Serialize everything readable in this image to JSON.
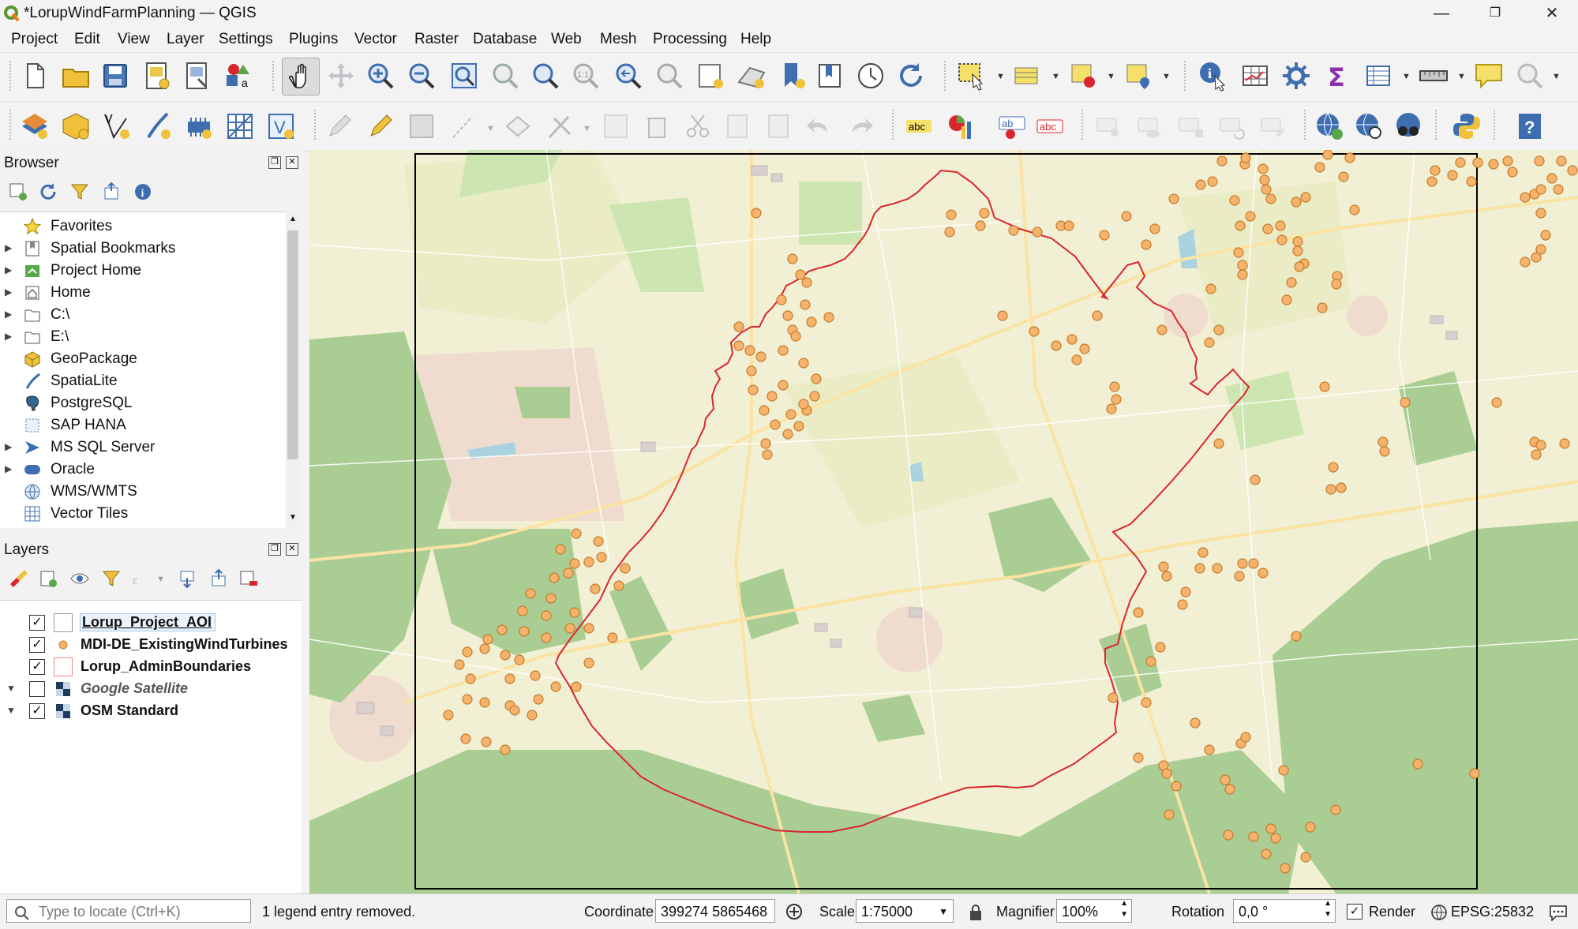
{
  "window": {
    "title": "*LorupWindFarmPlanning — QGIS",
    "minimize": "—",
    "restore": "❐",
    "close": "✕"
  },
  "menu": [
    "Project",
    "Edit",
    "View",
    "Layer",
    "Settings",
    "Plugins",
    "Vector",
    "Raster",
    "Database",
    "Web",
    "Mesh",
    "Processing",
    "Help"
  ],
  "toolbar_icons": {
    "row1": [
      "new-project-icon",
      "open-project-icon",
      "save-project-icon",
      "new-print-layout-icon",
      "layout-manager-icon",
      "style-manager-icon",
      "pan-map-icon",
      "pan-to-selection-icon",
      "zoom-in-icon",
      "zoom-out-icon",
      "zoom-full-icon",
      "zoom-to-selection-icon",
      "zoom-to-layer-icon",
      "zoom-native-icon",
      "zoom-last-icon",
      "zoom-next-icon",
      "new-map-view-icon",
      "new-3d-map-view-icon",
      "new-spatial-bookmark-icon",
      "show-bookmarks-icon",
      "temporal-controller-icon",
      "refresh-icon",
      "select-features-icon",
      "open-attribute-table-icon",
      "deselect-icon",
      "select-by-location-icon",
      "identify-icon",
      "field-calculator-icon",
      "processing-toolbox-icon",
      "statistics-icon",
      "attribute-table-icon",
      "measure-icon",
      "map-tips-icon",
      "locator-icon"
    ],
    "row2": [
      "data-source-manager-icon",
      "new-geopackage-layer-icon",
      "new-shapefile-layer-icon",
      "new-spatialite-layer-icon",
      "new-temporary-layer-icon",
      "new-virtual-layer-icon",
      "new-mesh-layer-icon",
      "toggle-editing-icon",
      "current-edits-icon",
      "save-edits-icon",
      "digitize-icon",
      "vertex-tool-icon",
      "modify-attributes-icon",
      "delete-selected-icon",
      "cut-features-icon",
      "copy-features-icon",
      "paste-features-icon",
      "undo-icon",
      "redo-icon",
      "label-toolbar-icon",
      "diagram-icon",
      "highlight-pinned-labels-icon",
      "label-remove-icon",
      "pin-label-icon",
      "show-hide-label-icon",
      "move-label-icon",
      "rotate-label-icon",
      "change-label-icon",
      "wms-search-icon",
      "metasearch-icon",
      "quickmapservices-icon",
      "python-console-icon",
      "help-icon"
    ]
  },
  "browser": {
    "title": "Browser",
    "items": [
      {
        "label": "Favorites",
        "icon": "star-icon",
        "expandable": false
      },
      {
        "label": "Spatial Bookmarks",
        "icon": "bookmark-icon",
        "expandable": true
      },
      {
        "label": "Project Home",
        "icon": "project-home-icon",
        "expandable": true
      },
      {
        "label": "Home",
        "icon": "home-folder-icon",
        "expandable": true
      },
      {
        "label": "C:\\",
        "icon": "drive-icon",
        "expandable": true
      },
      {
        "label": "E:\\",
        "icon": "drive-icon",
        "expandable": true
      },
      {
        "label": "GeoPackage",
        "icon": "geopackage-icon",
        "expandable": false
      },
      {
        "label": "SpatiaLite",
        "icon": "spatialite-icon",
        "expandable": false
      },
      {
        "label": "PostgreSQL",
        "icon": "postgresql-icon",
        "expandable": false
      },
      {
        "label": "SAP HANA",
        "icon": "sap-hana-icon",
        "expandable": false
      },
      {
        "label": "MS SQL Server",
        "icon": "mssql-icon",
        "expandable": true
      },
      {
        "label": "Oracle",
        "icon": "oracle-icon",
        "expandable": true
      },
      {
        "label": "WMS/WMTS",
        "icon": "wms-icon",
        "expandable": false
      },
      {
        "label": "Vector Tiles",
        "icon": "vector-tiles-icon",
        "expandable": false
      }
    ]
  },
  "layers": {
    "title": "Layers",
    "items": [
      {
        "label": "Lorup_Project_AOI",
        "checked": true,
        "symbol": "polygon-outline-black",
        "selected": true,
        "expandable": false,
        "italic": false
      },
      {
        "label": "MDI-DE_ExistingWindTurbines",
        "checked": true,
        "symbol": "point-orange",
        "selected": false,
        "expandable": false,
        "italic": false
      },
      {
        "label": "Lorup_AdminBoundaries",
        "checked": true,
        "symbol": "polygon-outline-red",
        "selected": false,
        "expandable": false,
        "italic": false
      },
      {
        "label": "Google Satellite",
        "checked": false,
        "symbol": "raster-tile",
        "selected": false,
        "expandable": true,
        "italic": true
      },
      {
        "label": "OSM Standard",
        "checked": true,
        "symbol": "raster-tile",
        "selected": false,
        "expandable": true,
        "italic": false
      }
    ]
  },
  "status": {
    "locator_placeholder": "Type to locate (Ctrl+K)",
    "message": "1 legend entry removed.",
    "coordinate_label": "Coordinate",
    "coordinate_value": "399274  5865468",
    "scale_label": "Scale",
    "scale_value": "1:75000",
    "magnifier_label": "Magnifier",
    "magnifier_value": "100%",
    "rotation_label": "Rotation",
    "rotation_value": "0,0 °",
    "render_label": "Render",
    "render_checked": true,
    "crs": "EPSG:25832"
  },
  "colors": {
    "turbine_fill": "#f5b36b",
    "turbine_stroke": "#c47a2c",
    "admin_boundary": "#d9262e",
    "aoi_outline": "#000000",
    "map_base": "#f1f0d4",
    "forest": "#a9cd93"
  }
}
